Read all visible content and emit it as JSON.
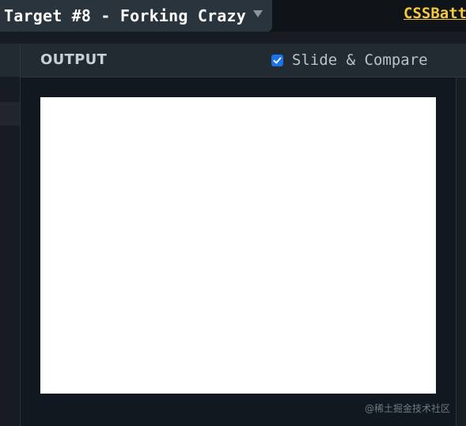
{
  "header": {
    "target_title": "Target #8 - Forking Crazy",
    "dropdown_icon": "caret-down-icon",
    "brand_link": "CSSBatt",
    "brand_color": "#f5c842"
  },
  "output": {
    "label": "OUTPUT",
    "slide_compare": {
      "label": "Slide & Compare",
      "checked": true,
      "icon": "checkmark-icon"
    },
    "canvas_color": "#ffffff"
  },
  "watermark": "@稀土掘金技术社区"
}
